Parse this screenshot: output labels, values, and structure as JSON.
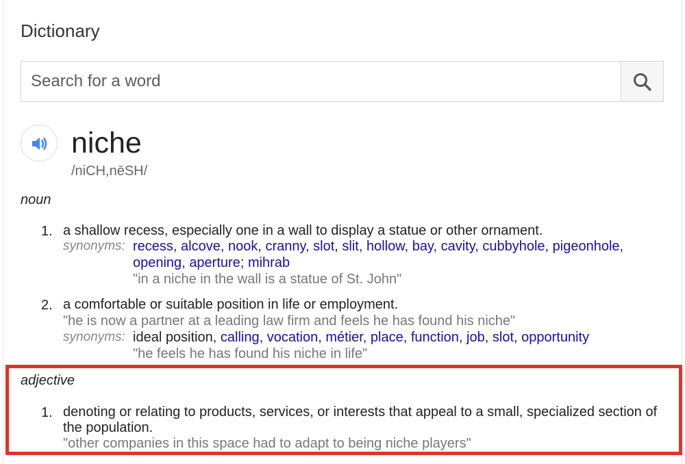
{
  "header": {
    "title": "Dictionary"
  },
  "search": {
    "placeholder": "Search for a word"
  },
  "entry": {
    "word": "niche",
    "phonetic": "/niCH,nēSH/",
    "noun": {
      "label": "noun",
      "senses": [
        {
          "number": "1.",
          "definition": "a shallow recess, especially one in a wall to display a statue or other ornament.",
          "synonyms_label": "synonyms:",
          "synonyms_line1": [
            "recess",
            "alcove",
            "nook",
            "cranny",
            "slot",
            "slit",
            "hollow",
            "bay",
            "cavity",
            "cubbyhole",
            "pigeonhole"
          ],
          "synonyms_line2": [
            "opening",
            "aperture",
            "mihrab"
          ],
          "example": "\"in a niche in the wall is a statue of St. John\""
        },
        {
          "number": "2.",
          "definition": "a comfortable or suitable position in life or employment.",
          "example": "\"he is now a partner at a leading law firm and feels he has found his niche\"",
          "synonyms_label": "synonyms:",
          "synonym_plain": "ideal position",
          "synonyms": [
            "calling",
            "vocation",
            "métier",
            "place",
            "function",
            "job",
            "slot",
            "opportunity"
          ],
          "synonym_example": "\"he feels he has found his niche in life\""
        }
      ]
    },
    "adjective": {
      "label": "adjective",
      "senses": [
        {
          "number": "1.",
          "definition_line1": "denoting or relating to products, services, or interests that appeal to a small, specialized section of",
          "definition_line2": "the population.",
          "example": "\"other companies in this space had to adapt to being niche players\""
        }
      ]
    }
  },
  "colors": {
    "link": "#1a0dab",
    "highlight": "#e53127",
    "audio_icon": "#4285f4"
  }
}
